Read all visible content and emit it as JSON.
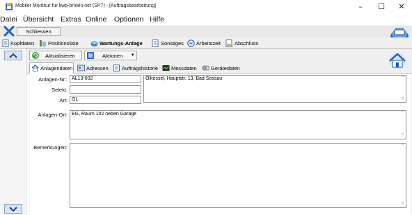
{
  "window": {
    "title": "Mobiler Monteur für kwp-bnWin.net (SP7) - [Auftragsbearbeitung]",
    "minimize": "–",
    "maximize": "☐",
    "close": "✕"
  },
  "menu": [
    "Datei",
    "Übersicht",
    "Extras",
    "Online",
    "Optionen",
    "Hilfe"
  ],
  "toolbar": {
    "close_label": "Schliessen"
  },
  "top_tabs": [
    "Kopfdaten",
    "Positionsliste",
    "Wartungs-Anlage",
    "Sonstiges",
    "Arbeitszeit",
    "Abschluss"
  ],
  "active_top_tab": "Wartungs-Anlage",
  "actions": {
    "refresh_label": "Aktualisieren",
    "actions_label": "Aktionen",
    "dropdown_arrow": "▾"
  },
  "sub_tabs": [
    "Anlagendaten",
    "Adressen",
    "Auftragshistorie",
    "Messdaten",
    "Gerätedaten"
  ],
  "active_sub_tab": "Anlagendaten",
  "form": {
    "anlagen_nr": {
      "label": "Anlagen-Nr.:",
      "value": "AL13-002"
    },
    "address": "Ölkessel, Hauptstr. 13, Bad Sossau",
    "selekt": {
      "label": "Selekt:",
      "value": ""
    },
    "art": {
      "label": "Art:",
      "value": "ÖL"
    },
    "anlagen_ort": {
      "label": "Anlagen-Ort:",
      "value": "EG, Raum 102 neben Garage"
    },
    "bemerkungen": {
      "label": "Bemerkungen:",
      "value": ""
    }
  },
  "scroll_arrows": {
    "up": "▲",
    "down": "▼",
    "up_small": "^",
    "down_small": "v"
  },
  "colors": {
    "accent_blue": "#1f5fbf",
    "tab_bar": "#f0f0f0",
    "panel_bg": "#f0f0f0",
    "field_border": "#8c8c8c"
  },
  "icons": {
    "app": "app-icon",
    "close_x": "x-icon",
    "logo": "toolbox-logo-icon",
    "refresh": "refresh-icon",
    "actions": "actions-icon",
    "home": "house-icon"
  }
}
